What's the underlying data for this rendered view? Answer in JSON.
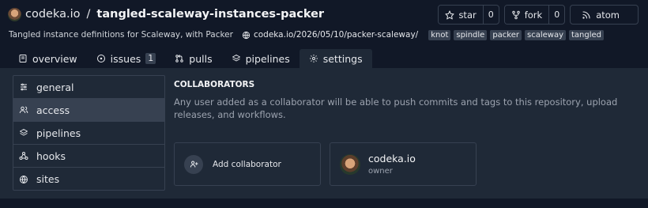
{
  "repo": {
    "owner": "codeka.io",
    "separator": "/",
    "name": "tangled-scaleway-instances-packer",
    "description": "Tangled instance definitions for Scaleway, with Packer",
    "website": "codeka.io/2026/05/10/packer-scaleway/",
    "topics": [
      "knot",
      "spindle",
      "packer",
      "scaleway",
      "tangled"
    ]
  },
  "actions": {
    "star_label": "star",
    "star_count": "0",
    "fork_label": "fork",
    "fork_count": "0",
    "atom_label": "atom"
  },
  "tabs": [
    {
      "label": "overview",
      "icon": "book-icon"
    },
    {
      "label": "issues",
      "icon": "circle-dot-icon",
      "badge": "1"
    },
    {
      "label": "pulls",
      "icon": "git-pull-request-icon"
    },
    {
      "label": "pipelines",
      "icon": "layers-icon"
    },
    {
      "label": "settings",
      "icon": "gear-icon",
      "active": true
    }
  ],
  "sidebar": {
    "items": [
      {
        "label": "general",
        "icon": "sliders-icon"
      },
      {
        "label": "access",
        "icon": "users-icon",
        "active": true
      },
      {
        "label": "pipelines",
        "icon": "layers-icon"
      },
      {
        "label": "hooks",
        "icon": "webhook-icon"
      },
      {
        "label": "sites",
        "icon": "globe-icon"
      }
    ]
  },
  "collaborators": {
    "title": "COLLABORATORS",
    "description": "Any user added as a collaborator will be able to push commits and tags to this repository, upload releases, and workflows.",
    "add_label": "Add collaborator",
    "members": [
      {
        "name": "codeka.io",
        "role": "owner"
      }
    ]
  },
  "colors": {
    "background": "#111827",
    "panel": "#1f2937",
    "border": "#374151",
    "muted_text": "#9ca3af"
  }
}
